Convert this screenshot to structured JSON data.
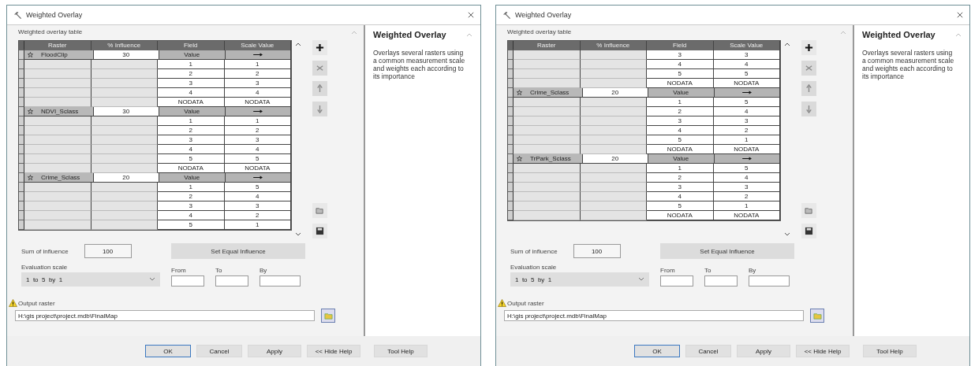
{
  "dialogs": [
    {
      "title": "Weighted Overlay",
      "table_label": "Weighted overlay table",
      "columns": [
        "Raster",
        "% Influence",
        "Field",
        "Scale Value"
      ],
      "rows": [
        {
          "kind": "raster",
          "raster": "FloodClip",
          "influence": "30",
          "field": "Value"
        },
        {
          "kind": "value",
          "field": "1",
          "scale": "1"
        },
        {
          "kind": "value",
          "field": "2",
          "scale": "2"
        },
        {
          "kind": "value",
          "field": "3",
          "scale": "3"
        },
        {
          "kind": "value",
          "field": "4",
          "scale": "4"
        },
        {
          "kind": "value",
          "field": "NODATA",
          "scale": "NODATA"
        },
        {
          "kind": "raster",
          "raster": "NDVI_Sclass",
          "influence": "30",
          "field": "Value"
        },
        {
          "kind": "value",
          "field": "1",
          "scale": "1"
        },
        {
          "kind": "value",
          "field": "2",
          "scale": "2"
        },
        {
          "kind": "value",
          "field": "3",
          "scale": "3"
        },
        {
          "kind": "value",
          "field": "4",
          "scale": "4"
        },
        {
          "kind": "value",
          "field": "5",
          "scale": "5"
        },
        {
          "kind": "value",
          "field": "NODATA",
          "scale": "NODATA"
        },
        {
          "kind": "raster",
          "raster": "Crime_Sclass",
          "influence": "20",
          "field": "Value"
        },
        {
          "kind": "value",
          "field": "1",
          "scale": "5"
        },
        {
          "kind": "value",
          "field": "2",
          "scale": "4"
        },
        {
          "kind": "value",
          "field": "3",
          "scale": "3"
        },
        {
          "kind": "value",
          "field": "4",
          "scale": "2"
        },
        {
          "kind": "value",
          "field": "5",
          "scale": "1"
        }
      ],
      "sum_label": "Sum of influence",
      "sum": "100",
      "equal_button": "Set Equal Influence",
      "scale_label": "Evaluation scale",
      "scale": "1  to  5  by  1",
      "from_label": "From",
      "to_label": "To",
      "by_label": "By",
      "output_label": "Output raster",
      "output": "H:\\gis project\\project.mdb\\FinalMap",
      "buttons": [
        {
          "label": "OK",
          "default": true
        },
        {
          "label": "Cancel",
          "default": false
        },
        {
          "label": "Apply",
          "default": false
        },
        {
          "label": "<< Hide Help",
          "default": false
        },
        {
          "label": "Tool Help",
          "default": false
        }
      ],
      "help": {
        "title": "Weighted Overlay",
        "text": "Overlays several rasters using a common measurement scale and weights each according to its importance"
      }
    },
    {
      "title": "Weighted Overlay",
      "table_label": "Weighted overlay table",
      "columns": [
        "Raster",
        "% Influence",
        "Field",
        "Scale Value"
      ],
      "rows": [
        {
          "kind": "value",
          "field": "3",
          "scale": "3"
        },
        {
          "kind": "value",
          "field": "4",
          "scale": "4"
        },
        {
          "kind": "value",
          "field": "5",
          "scale": "5"
        },
        {
          "kind": "value",
          "field": "NODATA",
          "scale": "NODATA"
        },
        {
          "kind": "raster",
          "raster": "Crime_Sclass",
          "influence": "20",
          "field": "Value"
        },
        {
          "kind": "value",
          "field": "1",
          "scale": "5"
        },
        {
          "kind": "value",
          "field": "2",
          "scale": "4"
        },
        {
          "kind": "value",
          "field": "3",
          "scale": "3"
        },
        {
          "kind": "value",
          "field": "4",
          "scale": "2"
        },
        {
          "kind": "value",
          "field": "5",
          "scale": "1"
        },
        {
          "kind": "value",
          "field": "NODATA",
          "scale": "NODATA"
        },
        {
          "kind": "raster",
          "raster": "TrPark_Sclass",
          "influence": "20",
          "field": "Value"
        },
        {
          "kind": "value",
          "field": "1",
          "scale": "5"
        },
        {
          "kind": "value",
          "field": "2",
          "scale": "4"
        },
        {
          "kind": "value",
          "field": "3",
          "scale": "3"
        },
        {
          "kind": "value",
          "field": "4",
          "scale": "2"
        },
        {
          "kind": "value",
          "field": "5",
          "scale": "1"
        },
        {
          "kind": "value",
          "field": "NODATA",
          "scale": "NODATA"
        }
      ],
      "sum_label": "Sum of influence",
      "sum": "100",
      "equal_button": "Set Equal Influence",
      "scale_label": "Evaluation scale",
      "scale": "1  to  5  by  1",
      "from_label": "From",
      "to_label": "To",
      "by_label": "By",
      "output_label": "Output raster",
      "output": "H:\\gis project\\project.mdb\\FinalMap",
      "buttons": [
        {
          "label": "OK",
          "default": true
        },
        {
          "label": "Cancel",
          "default": false
        },
        {
          "label": "Apply",
          "default": false
        },
        {
          "label": "<< Hide Help",
          "default": false
        },
        {
          "label": "Tool Help",
          "default": false
        }
      ],
      "help": {
        "title": "Weighted Overlay",
        "text": "Overlays several rasters using a common measurement scale and weights each according to its importance"
      }
    }
  ]
}
